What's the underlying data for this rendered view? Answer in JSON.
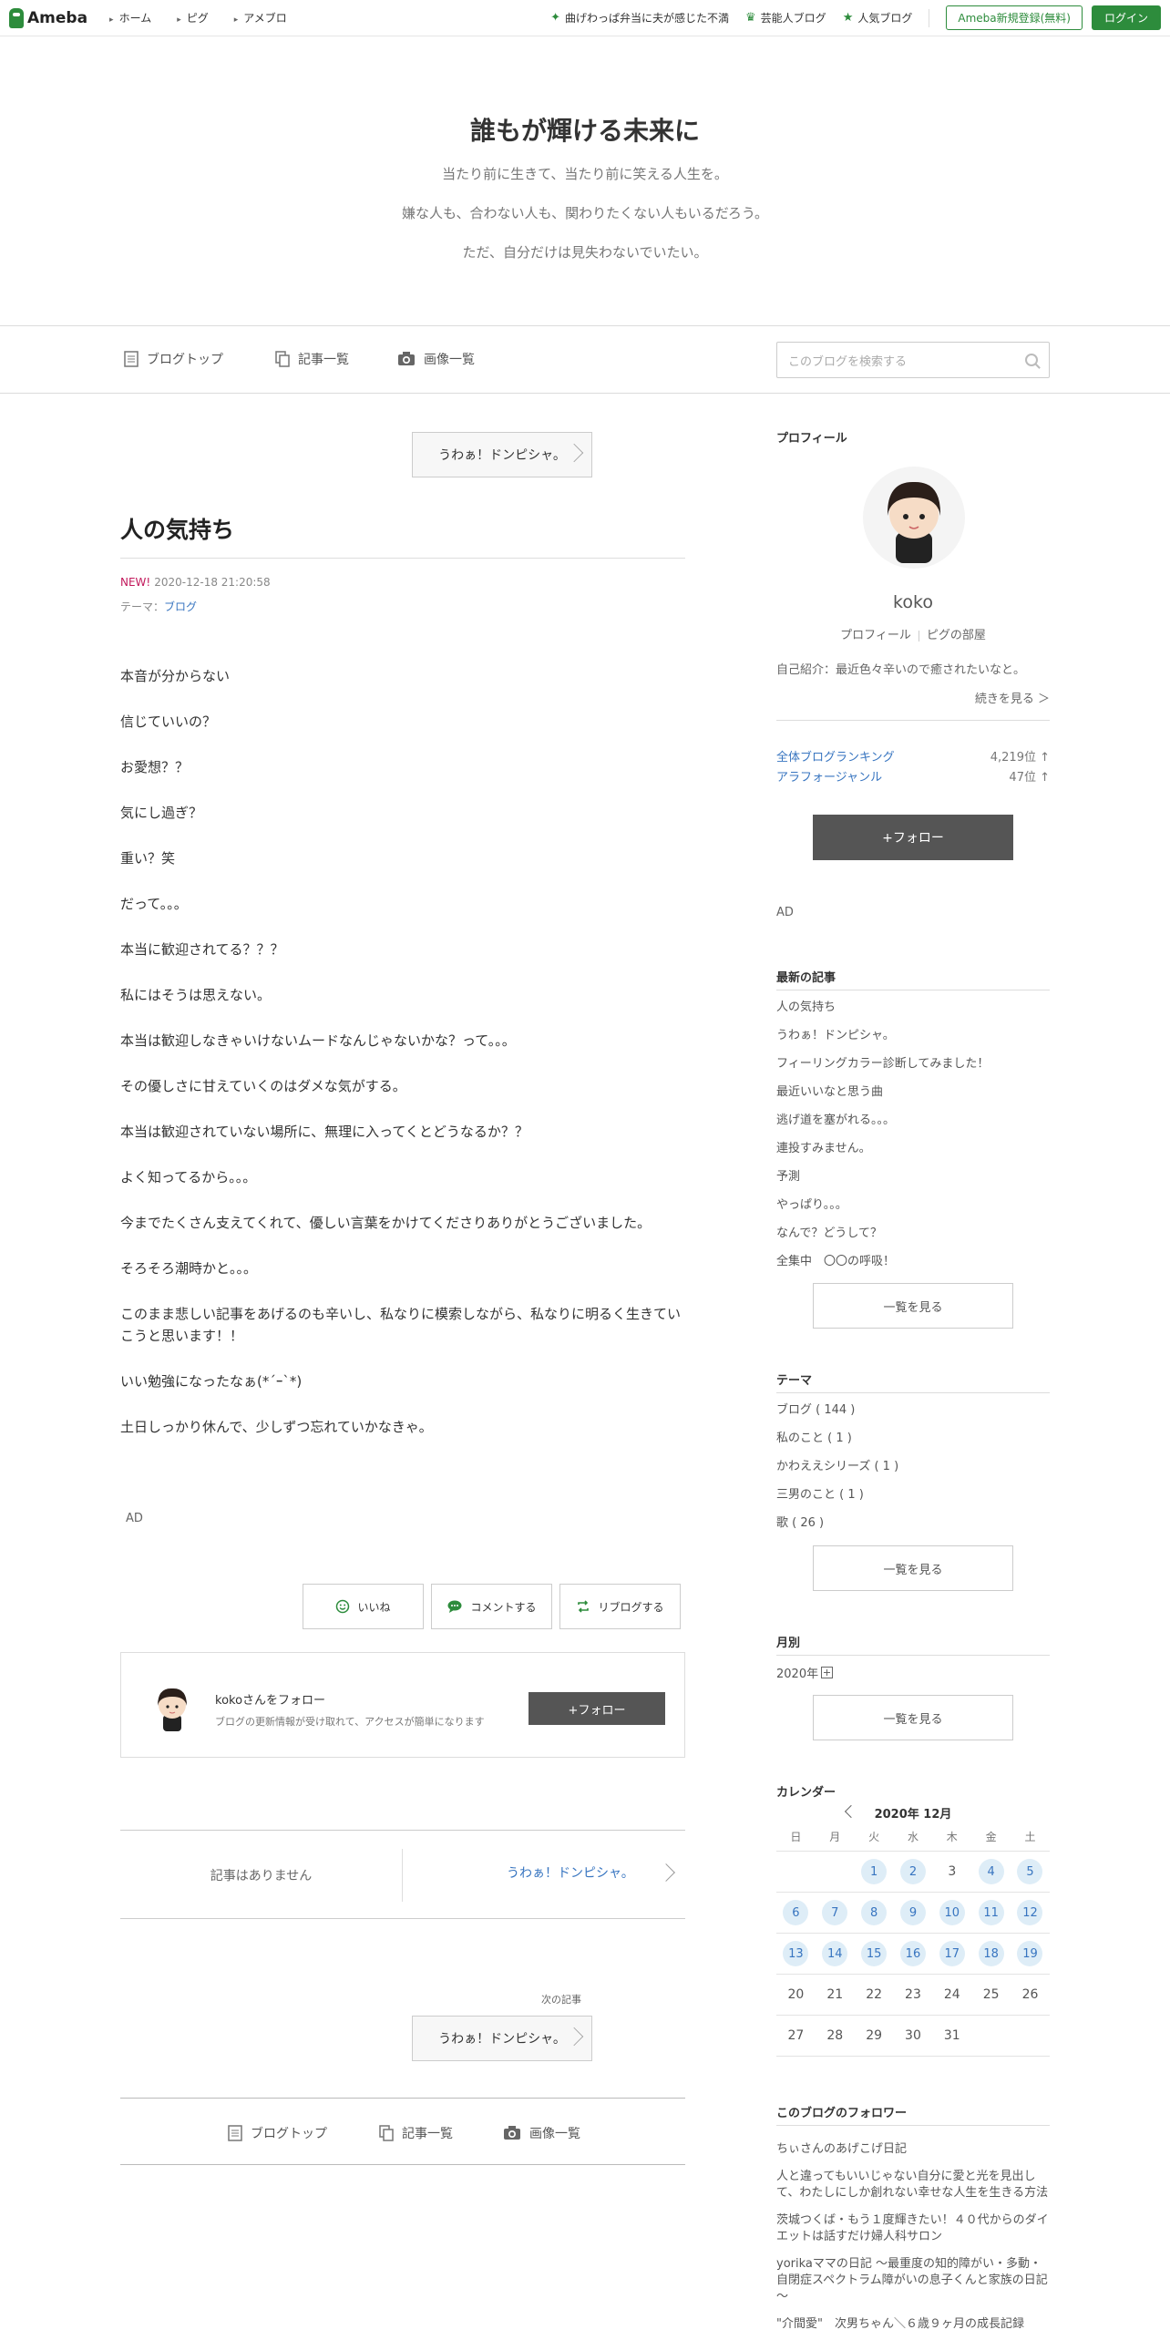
{
  "topbar": {
    "logo": "Ameba",
    "nav": [
      "ホーム",
      "ピグ",
      "アメブロ"
    ],
    "links": [
      "曲げわっぱ弁当に夫が感じた不満",
      "芸能人ブログ",
      "人気ブログ"
    ],
    "register": "Ameba新規登録(無料)",
    "login": "ログイン"
  },
  "header": {
    "title": "誰もが輝ける未来に",
    "desc": [
      "当たり前に生きて、当たり前に笑える人生を。",
      "嫌な人も、合わない人も、関わりたくない人もいるだろう。",
      "ただ、自分だけは見失わないでいたい。"
    ]
  },
  "blognav": {
    "top": "ブログトップ",
    "list": "記事一覧",
    "images": "画像一覧",
    "search_placeholder": "このブログを検索する"
  },
  "entry": {
    "prev_btn": "うわぁ！ドンピシャ。",
    "title": "人の気持ち",
    "new": "NEW!",
    "datetime": "2020-12-18 21:20:58",
    "theme_label": "テーマ：",
    "theme": "ブログ",
    "paragraphs": [
      "本音が分からない",
      "信じていいの？",
      "お愛想？？",
      "気にし過ぎ？",
      "重い？笑",
      "だって。。。",
      "本当に歓迎されてる？？？",
      "私にはそうは思えない。",
      "本当は歓迎しなきゃいけないムードなんじゃないかな？って。。。",
      "その優しさに甘えていくのはダメな気がする。",
      "本当は歓迎されていない場所に、無理に入ってくとどうなるか？？",
      "よく知ってるから。。。",
      "今までたくさん支えてくれて、優しい言葉をかけてくださりありがとうございました。",
      "そろそろ潮時かと。。。",
      "このまま悲しい記事をあげるのも辛いし、私なりに模索しながら、私なりに明るく生きていこうと思います！！",
      "いい勉強になったなぁ(*´ｰ`*)",
      "土日しっかり休んで、少しずつ忘れていかなきゃ。"
    ],
    "ad": "AD",
    "like": "いいね",
    "comment": "コメントする",
    "reblog": "リブログする",
    "follow_title": "kokoさんをフォロー",
    "follow_sub": "ブログの更新情報が受け取れて、アクセスが簡単になります",
    "follow_btn": "+フォロー",
    "no_article": "記事はありません",
    "next_link": "うわぁ！ドンピシャ。",
    "next_label": "次の記事",
    "next_btn": "うわぁ！ドンピシャ。"
  },
  "sidebar": {
    "profile_head": "プロフィール",
    "name": "koko",
    "profile_link": "プロフィール",
    "pig_link": "ピグの部屋",
    "intro": "自己紹介：最近色々辛いので癒されたいなと。",
    "more": "続きを見る ＞",
    "rank1_name": "全体ブログランキング",
    "rank1_val": "4,219位 ↑",
    "rank2_name": "アラフォージャンル",
    "rank2_val": "47位 ↑",
    "follow_btn": "+フォロー",
    "ad": "AD",
    "latest_head": "最新の記事",
    "latest": [
      "人の気持ち",
      "うわぁ！ドンピシャ。",
      "フィーリングカラー診断してみました！",
      "最近いいなと思う曲",
      "逃げ道を塞がれる。。。",
      "連投すみません。",
      "予測",
      "やっぱり。。。",
      "なんで？どうして？",
      "全集中　〇〇の呼吸！"
    ],
    "see_all": "一覧を見る",
    "theme_head": "テーマ",
    "themes": [
      "ブログ ( 144 )",
      "私のこと ( 1 )",
      "かわええシリーズ ( 1 )",
      "三男のこと ( 1 )",
      "歌 ( 26 )"
    ],
    "monthly_head": "月別",
    "month": "2020年",
    "calendar_head": "カレンダー",
    "cal_title": "2020年 12月",
    "weekdays": [
      "日",
      "月",
      "火",
      "水",
      "木",
      "金",
      "土"
    ],
    "weeks": [
      [
        "",
        "",
        "1",
        "2",
        "3",
        "4",
        "5"
      ],
      [
        "6",
        "7",
        "8",
        "9",
        "10",
        "11",
        "12"
      ],
      [
        "13",
        "14",
        "15",
        "16",
        "17",
        "18",
        "19"
      ],
      [
        "20",
        "21",
        "22",
        "23",
        "24",
        "25",
        "26"
      ],
      [
        "27",
        "28",
        "29",
        "30",
        "31",
        "",
        ""
      ]
    ],
    "posted_days": [
      "1",
      "2",
      "4",
      "5",
      "6",
      "7",
      "8",
      "9",
      "10",
      "11",
      "12",
      "13",
      "14",
      "15",
      "16",
      "17",
      "18",
      "19"
    ],
    "followers_head": "このブログのフォロワー",
    "followers": [
      "ちぃさんのあげこげ日記",
      "人と違ってもいいじゃない自分に愛と光を見出して、わたしにしか創れない幸せな人生を生きる方法",
      "茨城つくば・もう１度輝きたい！４０代からのダイエットは話すだけ婦人科サロン",
      "yorikaママの日記 ～最重度の知的障がい・多動・自閉症スペクトラム障がいの息子くんと家族の日記～",
      "\"介間愛\"　次男ちゃん＼６歳９ヶ月の成長記録"
    ]
  }
}
